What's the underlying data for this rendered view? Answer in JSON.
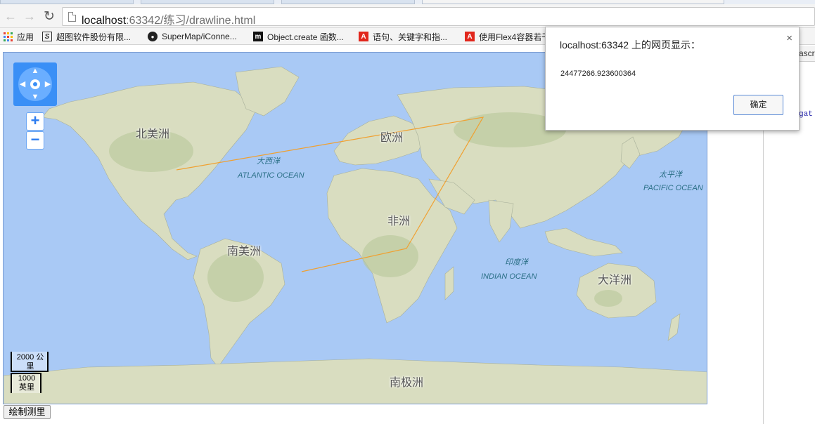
{
  "browser": {
    "url_host": "localhost",
    "url_rest": ":63342/练习/drawline.html"
  },
  "bookmarks": [
    {
      "label": "应用",
      "icon": "apps-grid-icon"
    },
    {
      "label": "超图软件股份有限...",
      "icon": "supermap-s-icon"
    },
    {
      "label": "SuperMap/iConne...",
      "icon": "github-icon"
    },
    {
      "label": "Object.create 函数...",
      "icon": "m-site-icon"
    },
    {
      "label": "语句、关键字和指...",
      "icon": "adobe-icon"
    },
    {
      "label": "使用Flex4容器若干",
      "icon": "adobe-icon"
    }
  ],
  "map": {
    "continents": [
      {
        "name": "北美洲"
      },
      {
        "name": "欧洲"
      },
      {
        "name": "非洲"
      },
      {
        "name": "南美洲"
      },
      {
        "name": "大洋洲"
      },
      {
        "name": "南极洲"
      }
    ],
    "oceans": [
      {
        "zh": "大西洋",
        "en": "ATLANTIC OCEAN"
      },
      {
        "zh": "太平洋",
        "en": "PACIFIC OCEAN"
      },
      {
        "zh": "印度洋",
        "en": "INDIAN OCEAN"
      }
    ],
    "scale": {
      "metric": "2000 公里",
      "imperial": "1000 英里"
    },
    "zoom_in": "+",
    "zoom_out": "−",
    "line_color": "#f0a030"
  },
  "draw_button": "绘制测里",
  "dialog": {
    "title": "localhost:63342 上的网页显示：",
    "message": "24477266.923600364",
    "ok": "确定",
    "close": "×"
  },
  "devtools": {
    "tab_text": "ascri",
    "code_text": "gat"
  }
}
